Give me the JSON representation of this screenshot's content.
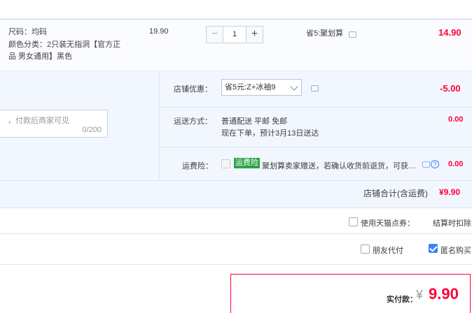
{
  "item": {
    "sku_size": "尺码：均码",
    "sku_color_line1": "颜色分类：2只装无指洞【官方正",
    "sku_color_line2": "品 男女通用】黑色",
    "unit_price": "19.90",
    "quantity": "1",
    "minus": "−",
    "plus": "+",
    "promo": "省5:聚划算",
    "subtotal": "14.90"
  },
  "shop": {
    "coupon_label": "店铺优惠：",
    "coupon_value": "省5元:Z+冰袖9",
    "coupon_amount": "-5.00",
    "memo_placeholder": "，付款后商家可见",
    "memo_count": "0/200",
    "shipping_label": "运送方式：",
    "shipping_line1": "普通配送 平邮 免邮",
    "shipping_line2": "现在下单，预计3月13日送达",
    "shipping_amount": "0.00",
    "insurance_label": "运费险：",
    "insurance_badge": "运费险",
    "insurance_text": "聚划算卖家赠送，若确认收货前退货，可获…",
    "insurance_amount": "0.00",
    "total_label": "店铺合计(含运费)",
    "total_value": "¥9.90"
  },
  "options": {
    "tmall_points": "使用天猫点券：",
    "settle_note": "结算时扣除",
    "friend_pay": "朋友代付",
    "anonymous": "匿名购买"
  },
  "final": {
    "label": "实付款：",
    "currency": "¥",
    "amount": "9.90"
  },
  "colors": {
    "accent_red": "#ff0036",
    "panel_bg": "#f2f7ff",
    "checkbox_blue": "#3b83f0",
    "badge_green": "#2ba345"
  }
}
